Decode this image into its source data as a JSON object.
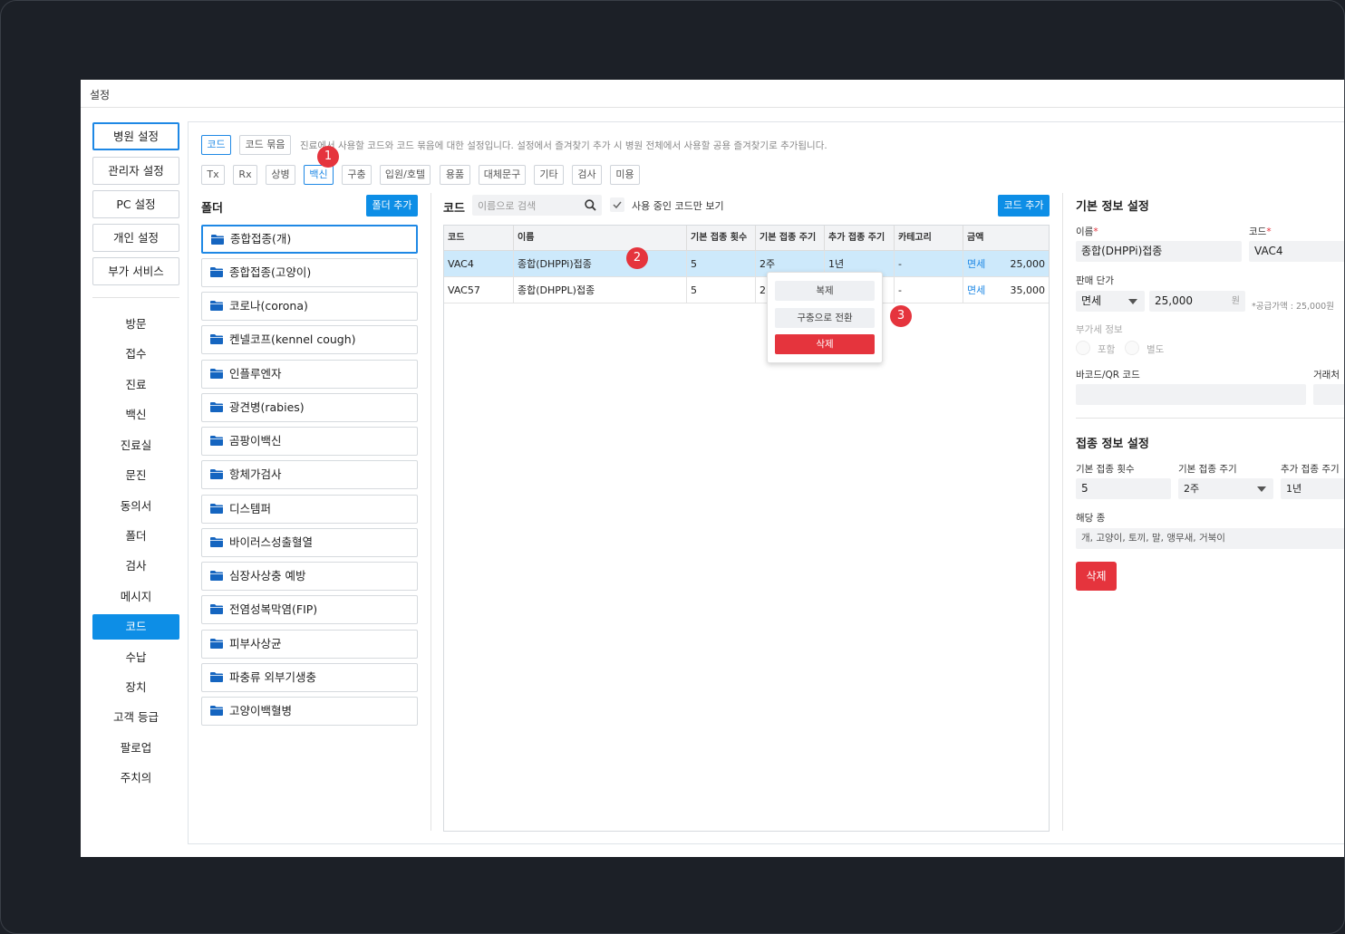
{
  "window": {
    "title": "설정"
  },
  "sidebar": {
    "top_buttons": [
      "병원 설정",
      "관리자 설정",
      "PC 설정",
      "개인 설정",
      "부가 서비스"
    ],
    "items": [
      "방문",
      "접수",
      "진료",
      "백신",
      "진료실",
      "문진",
      "동의서",
      "폴더",
      "검사",
      "메시지",
      "코드",
      "수납",
      "장치",
      "고객 등급",
      "팔로업",
      "주치의"
    ],
    "active_item": "코드"
  },
  "header": {
    "mode_tabs": [
      "코드",
      "코드 묶음"
    ],
    "description": "진료에서 사용할 코드와 코드 묶음에 대한 설정입니다. 설정에서 즐겨찾기 추가 시 병원 전체에서 사용할 공용 즐겨찾기로 추가됩니다.",
    "category_tabs": [
      "Tx",
      "Rx",
      "상병",
      "백신",
      "구충",
      "입원/호텔",
      "용품",
      "대체문구",
      "기타",
      "검사",
      "미용"
    ],
    "active_category": "백신"
  },
  "badges": [
    "1",
    "2",
    "3"
  ],
  "folders": {
    "title": "폴더",
    "add_label": "폴더 추가",
    "items": [
      "종합접종(개)",
      "종합접종(고양이)",
      "코로나(corona)",
      "켄넬코프(kennel cough)",
      "인플루엔자",
      "광견병(rabies)",
      "곰팡이백신",
      "항체가검사",
      "디스템퍼",
      "바이러스성출혈열",
      "심장사상충 예방",
      "전염성복막염(FIP)",
      "피부사상균",
      "파충류 외부기생충",
      "고양이백혈병"
    ]
  },
  "codes": {
    "title": "코드",
    "search_placeholder": "이름으로 검색",
    "only_active_label": "사용 중인 코드만 보기",
    "add_label": "코드 추가",
    "columns": [
      "코드",
      "이름",
      "기본 접종 횟수",
      "기본 접종 주기",
      "추가 접종 주기",
      "카테고리",
      "금액"
    ],
    "rows": [
      {
        "code": "VAC4",
        "name": "종합(DHPPi)접종",
        "count": "5",
        "cycle": "2주",
        "extra": "1년",
        "category": "-",
        "tax": "면세",
        "price": "25,000"
      },
      {
        "code": "VAC57",
        "name": "종합(DHPPL)접종",
        "count": "5",
        "cycle": "2",
        "extra": "",
        "category": "-",
        "tax": "면세",
        "price": "35,000"
      }
    ]
  },
  "context_menu": {
    "duplicate": "복제",
    "convert": "구충으로 전환",
    "delete": "삭제"
  },
  "detail": {
    "basic_title": "기본 정보 설정",
    "name_label": "이름",
    "name_value": "종합(DHPPi)접종",
    "code_label": "코드",
    "code_value": "VAC4",
    "price_label": "판매 단가",
    "tax_select": "면세",
    "price_value": "25,000",
    "currency": "원",
    "supply_note": "*공급가액 : 25,000원",
    "vat_label": "부가세 정보",
    "vat_include": "포함",
    "vat_separate": "별도",
    "barcode_label": "바코드/QR 코드",
    "vendor_label": "거래처",
    "vaccine_title": "접종 정보 설정",
    "count_label": "기본 접종 횟수",
    "count_value": "5",
    "cycle_label": "기본 접종 주기",
    "cycle_value": "2주",
    "extra_label": "추가 접종 주기",
    "extra_value": "1년",
    "species_label": "해당 종",
    "species_value": "개, 고양이, 토끼, 말, 앵무새, 거북이",
    "delete_label": "삭제"
  },
  "colors": {
    "accent": "#0d8ee6",
    "danger": "#e5343d",
    "selected_row": "#cde9fb"
  }
}
